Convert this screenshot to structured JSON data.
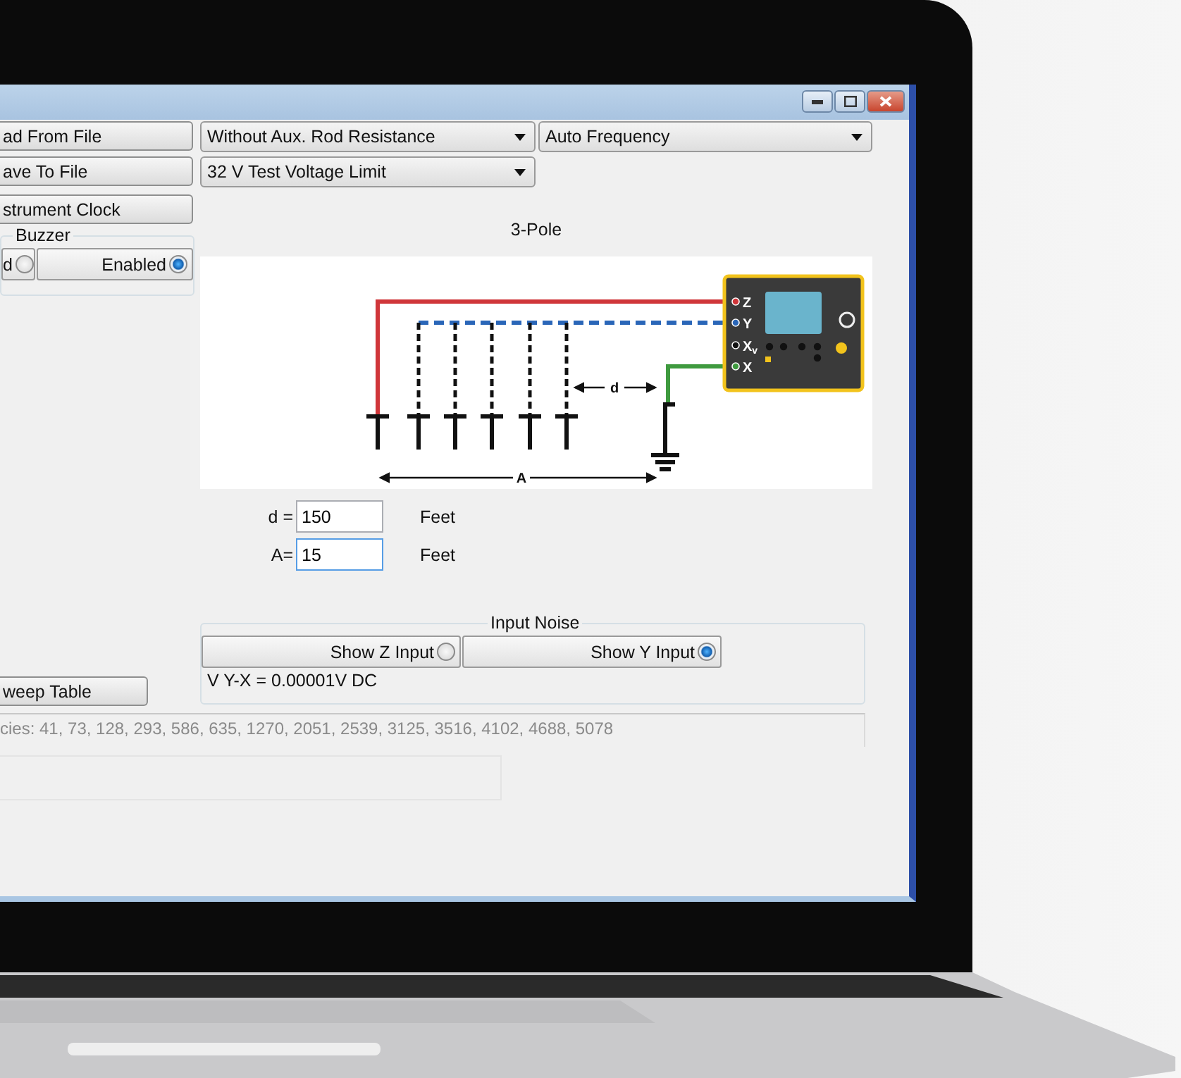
{
  "left_buttons": [
    "ad From File",
    "ave To File",
    "strument Clock"
  ],
  "buzzer": {
    "title": "Buzzer",
    "options": [
      {
        "label": "d",
        "selected": false
      },
      {
        "label": "Enabled",
        "selected": true
      }
    ]
  },
  "sweep_button": "weep Table",
  "dropdowns": [
    {
      "value": "Without Aux. Rod Resistance"
    },
    {
      "value": "Auto Frequency"
    },
    {
      "value": "32 V Test Voltage Limit"
    }
  ],
  "diagram": {
    "title": "3-Pole",
    "d_label": "d",
    "a_label": "A",
    "terminals": [
      {
        "text": "Z"
      },
      {
        "text": "Y"
      },
      {
        "text": "X",
        "sub": "v"
      },
      {
        "text": "X"
      }
    ]
  },
  "fields": [
    {
      "label": "d =",
      "value": "150",
      "unit": "Feet",
      "focused": false
    },
    {
      "label": "A=",
      "value": "15",
      "unit": "Feet",
      "focused": true
    }
  ],
  "input_noise": {
    "title": "Input Noise",
    "options": [
      {
        "label": "Show Z Input",
        "selected": false
      },
      {
        "label": "Show Y Input",
        "selected": true
      }
    ],
    "reading": "V Y-X = 0.00001V DC"
  },
  "frequencies": "cies: 41, 73, 128, 293, 586, 635, 1270, 2051, 2539, 3125, 3516, 4102, 4688, 5078"
}
